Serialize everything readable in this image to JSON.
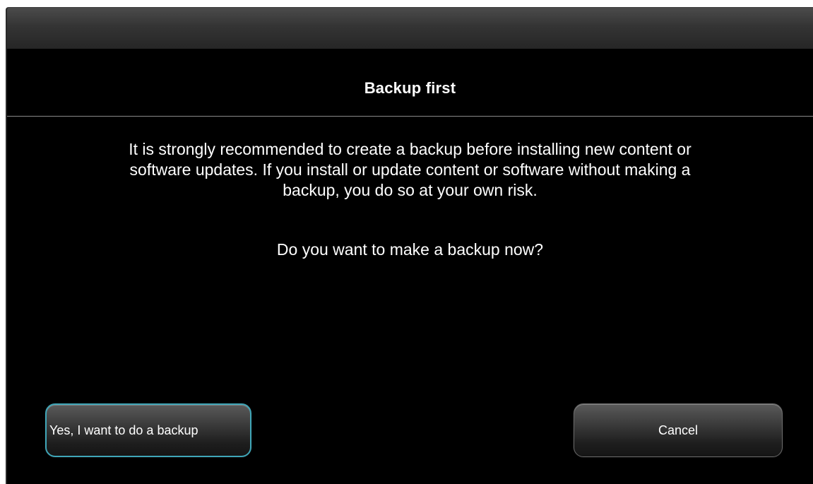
{
  "dialog": {
    "title": "Backup first",
    "message": "It is strongly recommended to create a backup before installing new content or\nsoftware updates. If you install or update content or software without making a\nbackup, you do so at your own risk.",
    "question": "Do you want to make a backup now?"
  },
  "buttons": {
    "yes_label": "Yes, I want to do a backup",
    "cancel_label": "Cancel"
  },
  "colors": {
    "background": "#000000",
    "text": "#ffffff",
    "focus_border": "#3fa6b8"
  }
}
